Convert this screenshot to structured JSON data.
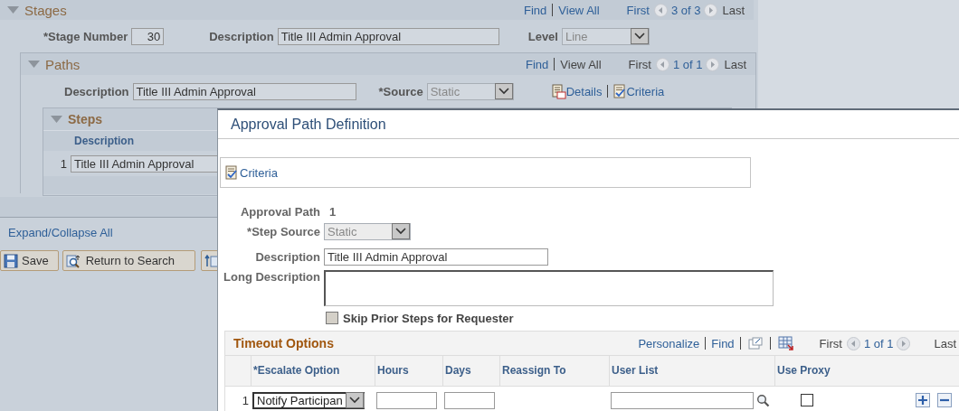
{
  "stages": {
    "title": "Stages",
    "nav": {
      "links": [
        {
          "text": "Find",
          "disabled": false
        },
        {
          "text": "View All",
          "disabled": false
        }
      ],
      "first": {
        "text": "First",
        "disabled": false
      },
      "count": "3 of 3",
      "last": {
        "text": "Last",
        "disabled": true
      }
    },
    "stage_number": {
      "label": "*Stage Number",
      "value": "30"
    },
    "description": {
      "label": "Description",
      "value": "Title III Admin Approval"
    },
    "level": {
      "label": "Level",
      "value": "Line"
    }
  },
  "paths": {
    "title": "Paths",
    "nav": {
      "links": [
        {
          "text": "Find",
          "disabled": false
        },
        {
          "text": "View All",
          "disabled": true
        }
      ],
      "first": {
        "text": "First",
        "disabled": true
      },
      "count": "1 of 1",
      "last": {
        "text": "Last",
        "disabled": true
      }
    },
    "description": {
      "label": "Description",
      "value": "Title III Admin Approval"
    },
    "source": {
      "label": "*Source",
      "value": "Static"
    },
    "links": [
      {
        "kind": "details",
        "text": "Details"
      },
      {
        "kind": "criteria",
        "text": "Criteria"
      }
    ]
  },
  "steps": {
    "title": "Steps",
    "column": "Description",
    "rows": [
      {
        "number": "1",
        "description": "Title III Admin Approval"
      }
    ]
  },
  "expand_collapse": "Expand/Collapse All",
  "buttons": [
    {
      "kind": "save",
      "label": "Save"
    },
    {
      "kind": "search",
      "label": "Return to Search"
    }
  ],
  "dialog": {
    "title": "Approval Path Definition",
    "criteria_link": "Criteria",
    "approval_path": {
      "label": "Approval Path",
      "value": "1"
    },
    "step_source": {
      "label": "*Step Source",
      "value": "Static"
    },
    "description": {
      "label": "Description",
      "value": "Title III Admin Approval"
    },
    "long_description": {
      "label": "Long Description"
    },
    "skip_prior": {
      "label": "Skip Prior Steps for Requester",
      "checked": false
    },
    "timeout": {
      "title": "Timeout Options",
      "nav": {
        "links": [
          {
            "text": "Personalize",
            "disabled": false
          },
          {
            "text": "Find",
            "disabled": false
          }
        ],
        "first": {
          "text": "First",
          "disabled": true
        },
        "count": "1 of 1",
        "last": {
          "text": "Last",
          "disabled": true
        }
      },
      "columns": [
        "*Escalate Option",
        "Hours",
        "Days",
        "Reassign To",
        "User List",
        "Use Proxy"
      ],
      "rows": [
        {
          "number": "1",
          "escalate_option": "Notify Participan",
          "use_proxy": false
        }
      ]
    }
  }
}
